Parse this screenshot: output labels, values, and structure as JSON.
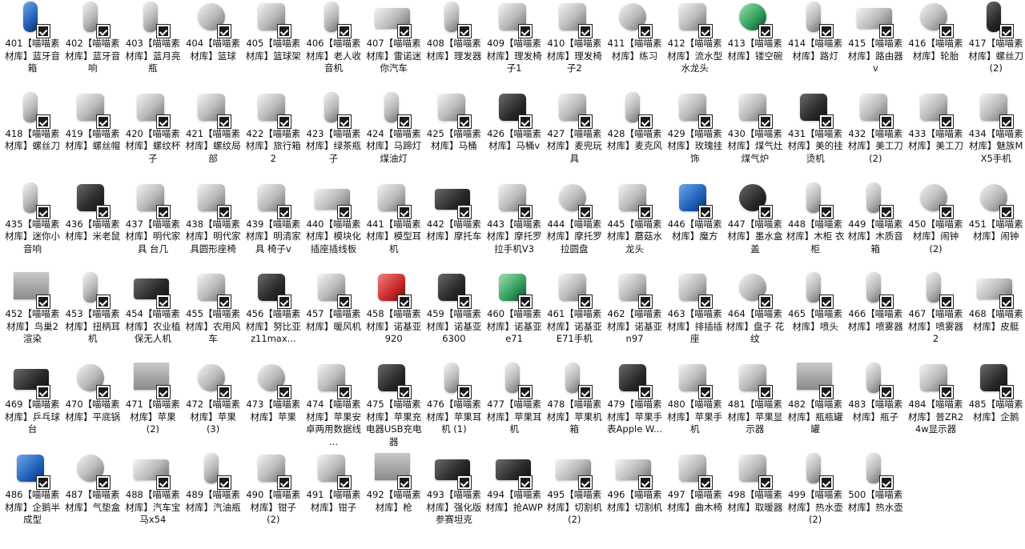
{
  "items": [
    {
      "label": "401【喵喵素材库】蓝牙音箱",
      "icon": "speaker-icon",
      "tone": "blue"
    },
    {
      "label": "402【喵喵素材库】蓝牙音响",
      "icon": "speaker-icon",
      "tone": "gray"
    },
    {
      "label": "403【喵喵素材库】蓝月亮瓶",
      "icon": "bottle-icon",
      "tone": "gray"
    },
    {
      "label": "404【喵喵素材库】篮球",
      "icon": "basketball-icon",
      "tone": "gray"
    },
    {
      "label": "405【喵喵素材库】篮球架",
      "icon": "hoop-icon",
      "tone": "gray"
    },
    {
      "label": "406【喵喵素材库】老人收音机",
      "icon": "radio-icon",
      "tone": "gray"
    },
    {
      "label": "407【喵喵素材库】雷诺迷你汽车",
      "icon": "car-icon",
      "tone": "gray"
    },
    {
      "label": "408【喵喵素材库】理发器",
      "icon": "clipper-icon",
      "tone": "gray"
    },
    {
      "label": "409【喵喵素材库】理发椅子1",
      "icon": "chair-icon",
      "tone": "gray"
    },
    {
      "label": "410【喵喵素材库】理发椅子2",
      "icon": "chair-icon",
      "tone": "gray"
    },
    {
      "label": "411【喵喵素材库】练习",
      "icon": "ring-icon",
      "tone": "gray"
    },
    {
      "label": "412【喵喵素材库】流水型水龙头",
      "icon": "faucet-icon",
      "tone": "gray"
    },
    {
      "label": "413【喵喵素材库】镂空碗",
      "icon": "bowl-icon",
      "tone": "green"
    },
    {
      "label": "414【喵喵素材库】路灯",
      "icon": "lamp-icon",
      "tone": "gray"
    },
    {
      "label": "415【喵喵素材库】路由器v",
      "icon": "router-icon",
      "tone": "gray"
    },
    {
      "label": "416【喵喵素材库】轮胎",
      "icon": "tire-icon",
      "tone": "gray"
    },
    {
      "label": "417【喵喵素材库】螺丝刀 (2)",
      "icon": "screwdriver-icon",
      "tone": "dark"
    },
    {
      "label": "418【喵喵素材库】螺丝刀",
      "icon": "screwdriver-icon",
      "tone": "gray"
    },
    {
      "label": "419【喵喵素材库】螺丝帽",
      "icon": "nut-icon",
      "tone": "gray"
    },
    {
      "label": "420【喵喵素材库】螺纹杯子",
      "icon": "cup-icon",
      "tone": "gray"
    },
    {
      "label": "421【喵喵素材库】螺纹局部",
      "icon": "screw-icon",
      "tone": "gray"
    },
    {
      "label": "422【喵喵素材库】旅行箱2",
      "icon": "suitcase-icon",
      "tone": "gray"
    },
    {
      "label": "423【喵喵素材库】绿茶瓶子",
      "icon": "bottle-icon",
      "tone": "gray"
    },
    {
      "label": "424【喵喵素材库】马蹄灯 煤油灯",
      "icon": "lantern-icon",
      "tone": "gray"
    },
    {
      "label": "425【喵喵素材库】马桶",
      "icon": "toilet-icon",
      "tone": "gray"
    },
    {
      "label": "426【喵喵素材库】马桶v",
      "icon": "toilet-icon",
      "tone": "dark"
    },
    {
      "label": "427【喵喵素材库】麦兜玩具",
      "icon": "toy-icon",
      "tone": "gray"
    },
    {
      "label": "428【喵喵素材库】麦克风",
      "icon": "microphone-icon",
      "tone": "gray"
    },
    {
      "label": "429【喵喵素材库】玫瑰挂饰",
      "icon": "ornament-icon",
      "tone": "gray"
    },
    {
      "label": "430【喵喵素材库】煤气灶 煤气炉",
      "icon": "stove-icon",
      "tone": "gray"
    },
    {
      "label": "431【喵喵素材库】美的挂烫机",
      "icon": "steamer-icon",
      "tone": "dark"
    },
    {
      "label": "432【喵喵素材库】美工刀 (2)",
      "icon": "knife-icon",
      "tone": "gray"
    },
    {
      "label": "433【喵喵素材库】美工刀",
      "icon": "knife-icon",
      "tone": "gray"
    },
    {
      "label": "434【喵喵素材库】魅族MX5手机",
      "icon": "phone-icon",
      "tone": "gray"
    },
    {
      "label": "435【喵喵素材库】迷你小音响",
      "icon": "speaker-icon",
      "tone": "gray"
    },
    {
      "label": "436【喵喵素材库】米老鼠",
      "icon": "bear-icon",
      "tone": "dark"
    },
    {
      "label": "437【喵喵素材库】明代家具 台几",
      "icon": "table-icon",
      "tone": "gray"
    },
    {
      "label": "438【喵喵素材库】明代家具圆形座椅",
      "icon": "stool-icon",
      "tone": "gray"
    },
    {
      "label": "439【喵喵素材库】明清家具 椅子v",
      "icon": "chair-icon",
      "tone": "gray"
    },
    {
      "label": "440【喵喵素材库】模块化插座插线板",
      "icon": "power-strip-icon",
      "tone": "gray"
    },
    {
      "label": "441【喵喵素材库】模型耳机",
      "icon": "headphones-icon",
      "tone": "gray"
    },
    {
      "label": "442【喵喵素材库】摩托车",
      "icon": "motorcycle-icon",
      "tone": "dark"
    },
    {
      "label": "443【喵喵素材库】摩托罗拉手机V3",
      "icon": "phone-icon",
      "tone": "gray"
    },
    {
      "label": "444【喵喵素材库】摩托罗拉圆盘",
      "icon": "disc-icon",
      "tone": "gray"
    },
    {
      "label": "445【喵喵素材库】蘑菇水龙头",
      "icon": "faucet-icon",
      "tone": "gray"
    },
    {
      "label": "446【喵喵素材库】魔方",
      "icon": "cube-icon",
      "tone": "blue"
    },
    {
      "label": "447【喵喵素材库】墨水盒盖",
      "icon": "lid-icon",
      "tone": "dark"
    },
    {
      "label": "448【喵喵素材库】木柜 衣柜",
      "icon": "cabinet-icon",
      "tone": "gray"
    },
    {
      "label": "449【喵喵素材库】木质音箱",
      "icon": "speaker-icon",
      "tone": "gray"
    },
    {
      "label": "450【喵喵素材库】闹钟 (2)",
      "icon": "clock-icon",
      "tone": "gray"
    },
    {
      "label": "451【喵喵素材库】闹钟",
      "icon": "clock-icon",
      "tone": "gray"
    },
    {
      "label": "452【喵喵素材库】鸟巢2渲染",
      "icon": "stadium-icon",
      "tone": "photo"
    },
    {
      "label": "453【喵喵素材库】扭柄耳机",
      "icon": "earphone-icon",
      "tone": "gray"
    },
    {
      "label": "454【喵喵素材库】农业植保无人机",
      "icon": "drone-icon",
      "tone": "dark"
    },
    {
      "label": "455【喵喵素材库】农用风车",
      "icon": "windmill-icon",
      "tone": "gray"
    },
    {
      "label": "456【喵喵素材库】努比亚z11max...",
      "icon": "phone-icon",
      "tone": "dark"
    },
    {
      "label": "457【喵喵素材库】暖风机",
      "icon": "heater-icon",
      "tone": "gray"
    },
    {
      "label": "458【喵喵素材库】诺基亚920",
      "icon": "phone-icon",
      "tone": "red"
    },
    {
      "label": "459【喵喵素材库】诺基亚6300",
      "icon": "phone-icon",
      "tone": "dark"
    },
    {
      "label": "460【喵喵素材库】诺基亚e71",
      "icon": "phone-icon",
      "tone": "green"
    },
    {
      "label": "461【喵喵素材库】诺基亚E71手机",
      "icon": "phone-icon",
      "tone": "gray"
    },
    {
      "label": "462【喵喵素材库】诺基亚n97",
      "icon": "phone-icon",
      "tone": "gray"
    },
    {
      "label": "463【喵喵素材库】排插插座",
      "icon": "socket-icon",
      "tone": "gray"
    },
    {
      "label": "464【喵喵素材库】盘子 花纹",
      "icon": "plate-icon",
      "tone": "gray"
    },
    {
      "label": "465【喵喵素材库】喷头",
      "icon": "nozzle-icon",
      "tone": "gray"
    },
    {
      "label": "466【喵喵素材库】喷雾器",
      "icon": "sprayer-icon",
      "tone": "gray"
    },
    {
      "label": "467【喵喵素材库】喷雾器2",
      "icon": "sprayer-icon",
      "tone": "gray"
    },
    {
      "label": "468【喵喵素材库】皮艇",
      "icon": "boat-icon",
      "tone": "gray"
    },
    {
      "label": "469【喵喵素材库】乒乓球台",
      "icon": "pingpong-table-icon",
      "tone": "dark"
    },
    {
      "label": "470【喵喵素材库】平底锅",
      "icon": "pan-icon",
      "tone": "gray"
    },
    {
      "label": "471【喵喵素材库】苹果 (2)",
      "icon": "apple-icon",
      "tone": "photo"
    },
    {
      "label": "472【喵喵素材库】苹果 (3)",
      "icon": "apple-icon",
      "tone": "gray"
    },
    {
      "label": "473【喵喵素材库】苹果",
      "icon": "apple-icon",
      "tone": "gray"
    },
    {
      "label": "474【喵喵素材库】苹果安卓两用数据线 ...",
      "icon": "cable-icon",
      "tone": "gray"
    },
    {
      "label": "475【喵喵素材库】苹果充电器USB充电器",
      "icon": "charger-icon",
      "tone": "dark"
    },
    {
      "label": "476【喵喵素材库】苹果耳机 (1)",
      "icon": "earphone-icon",
      "tone": "gray"
    },
    {
      "label": "477【喵喵素材库】苹果耳机",
      "icon": "earphone-icon",
      "tone": "gray"
    },
    {
      "label": "478【喵喵素材库】苹果机箱",
      "icon": "computer-case-icon",
      "tone": "gray"
    },
    {
      "label": "479【喵喵素材库】苹果手表Apple W...",
      "icon": "watch-icon",
      "tone": "dark"
    },
    {
      "label": "480【喵喵素材库】苹果手机",
      "icon": "phone-icon",
      "tone": "gray"
    },
    {
      "label": "481【喵喵素材库】苹果显示器",
      "icon": "monitor-icon",
      "tone": "gray"
    },
    {
      "label": "482【喵喵素材库】瓶瓶罐罐",
      "icon": "jars-icon",
      "tone": "photo"
    },
    {
      "label": "483【喵喵素材库】瓶子",
      "icon": "bottle-icon",
      "tone": "gray"
    },
    {
      "label": "484【喵喵素材库】普ZR24w显示器",
      "icon": "monitor-icon",
      "tone": "gray"
    },
    {
      "label": "485【喵喵素材库】企鹅",
      "icon": "penguin-icon",
      "tone": "dark"
    },
    {
      "label": "486【喵喵素材库】企鹅半成型",
      "icon": "penguin-icon",
      "tone": "blue"
    },
    {
      "label": "487【喵喵素材库】气垫盒",
      "icon": "compact-icon",
      "tone": "gray"
    },
    {
      "label": "488【喵喵素材库】汽车宝马x54",
      "icon": "car-icon",
      "tone": "gray"
    },
    {
      "label": "489【喵喵素材库】汽油瓶",
      "icon": "oil-bottle-icon",
      "tone": "gray"
    },
    {
      "label": "490【喵喵素材库】钳子 (2)",
      "icon": "pliers-icon",
      "tone": "gray"
    },
    {
      "label": "491【喵喵素材库】钳子",
      "icon": "pliers-icon",
      "tone": "gray"
    },
    {
      "label": "492【喵喵素材库】枪",
      "icon": "gun-icon",
      "tone": "photo"
    },
    {
      "label": "493【喵喵素材库】强化版参赛坦克",
      "icon": "tank-icon",
      "tone": "dark"
    },
    {
      "label": "494【喵喵素材库】抢AWP",
      "icon": "rifle-icon",
      "tone": "dark"
    },
    {
      "label": "495【喵喵素材库】切割机 (2)",
      "icon": "cutter-icon",
      "tone": "gray"
    },
    {
      "label": "496【喵喵素材库】切割机",
      "icon": "cutter-icon",
      "tone": "gray"
    },
    {
      "label": "497【喵喵素材库】曲木椅",
      "icon": "chair-icon",
      "tone": "gray"
    },
    {
      "label": "498【喵喵素材库】取暖器",
      "icon": "heater-icon",
      "tone": "gray"
    },
    {
      "label": "499【喵喵素材库】热水壶 (2)",
      "icon": "kettle-icon",
      "tone": "gray"
    },
    {
      "label": "500【喵喵素材库】热水壶",
      "icon": "kettle-icon",
      "tone": "gray"
    }
  ]
}
